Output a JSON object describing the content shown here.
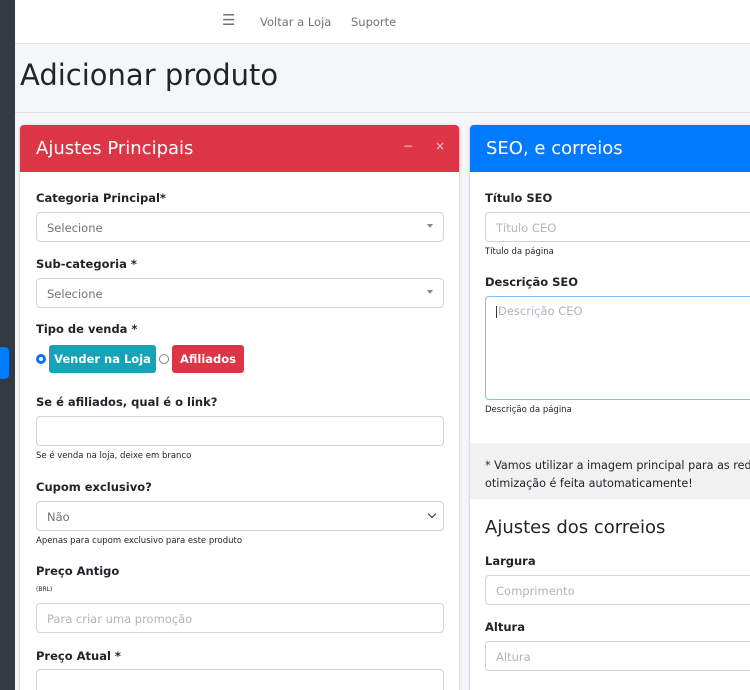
{
  "nav": {
    "menu_icon": "hamburger-icon",
    "links": [
      "Voltar a Loja",
      "Suporte"
    ]
  },
  "page": {
    "title": "Adicionar produto"
  },
  "main_card": {
    "title": "Ajustes Principais",
    "color": "#dc3545",
    "tools": {
      "minimize": "−",
      "close": "×"
    },
    "categoria": {
      "label": "Categoria Principal*",
      "value": "Selecione"
    },
    "subcategoria": {
      "label": "Sub-categoria *",
      "value": "Selecione"
    },
    "tipo_venda": {
      "label": "Tipo de venda *",
      "options": [
        {
          "label": "Vender na Loja",
          "selected": true,
          "color": "#17a2b8"
        },
        {
          "label": "Afiliados",
          "selected": false,
          "color": "#dc3545"
        }
      ]
    },
    "link_afiliado": {
      "label": "Se é afiliados, qual é o link?",
      "value": "",
      "help": "Se é venda na loja, deixe em branco"
    },
    "cupom": {
      "label": "Cupom exclusivo?",
      "value": "Não",
      "help": "Apenas para cupom exclusivo para este produto"
    },
    "preco_antigo": {
      "label": "Preço Antigo",
      "currency": "(BRL)",
      "placeholder": "Para criar uma promoção"
    },
    "preco_atual": {
      "label": "Preço Atual *",
      "value": ""
    }
  },
  "seo_card": {
    "title": "SEO, e correios",
    "color": "#007bff",
    "titulo_seo": {
      "label": "Título SEO",
      "placeholder": "Título CEO",
      "help": "Título da página"
    },
    "descricao_seo": {
      "label": "Descrição SEO",
      "placeholder": "Descrição CEO",
      "help": "Descrição da página"
    },
    "note": [
      "* Vamos utilizar a imagem principal para as redes",
      "otimização é feita automaticamente!"
    ],
    "correios": {
      "title": "Ajustes dos correios",
      "largura": {
        "label": "Largura",
        "placeholder": "Comprimento"
      },
      "altura": {
        "label": "Altura",
        "placeholder": "Altura"
      }
    }
  }
}
